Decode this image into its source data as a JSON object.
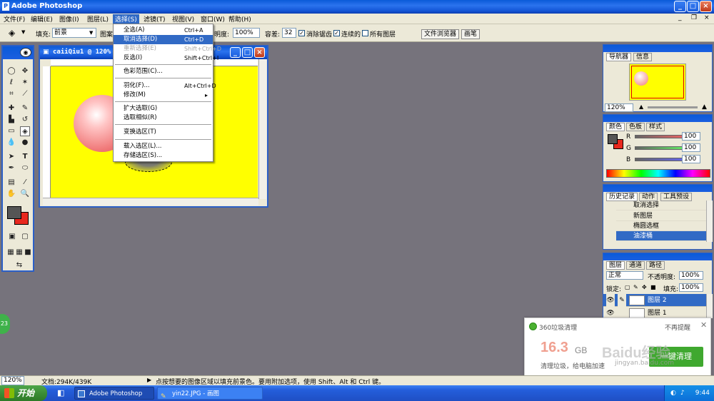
{
  "app": {
    "title": "Adobe Photoshop"
  },
  "menubar": {
    "items": [
      "文件(F)",
      "编辑(E)",
      "图像(I)",
      "图层(L)",
      "选择(S)",
      "滤镜(T)",
      "视图(V)",
      "窗口(W)",
      "帮助(H)"
    ]
  },
  "options": {
    "fill_label": "填充:",
    "fill_value": "前景",
    "pattern_label": "图案",
    "opacity_label": "明度:",
    "opacity_value": "100%",
    "tolerance_label": "容差:",
    "tolerance_value": "32",
    "antialias_label": "消除锯齿",
    "contiguous_label": "连续的",
    "all_layers_label": "所有图层",
    "file_browser_tab": "文件浏览器",
    "brushes_tab": "画笔"
  },
  "document": {
    "title": "caiiQiu1 @ 120%"
  },
  "select_menu": {
    "items": [
      {
        "label": "全选(A)",
        "shortcut": "Ctrl+A"
      },
      {
        "label": "取消选择(D)",
        "shortcut": "Ctrl+D"
      },
      {
        "label": "重新选择(E)",
        "shortcut": "Shift+Ctrl+D"
      },
      {
        "label": "反选(I)",
        "shortcut": "Shift+Ctrl+I"
      },
      {
        "label": "色彩范围(C)...",
        "shortcut": ""
      },
      {
        "label": "羽化(F)...",
        "shortcut": "Alt+Ctrl+D"
      },
      {
        "label": "修改(M)",
        "shortcut": "▸"
      },
      {
        "label": "扩大选取(G)",
        "shortcut": ""
      },
      {
        "label": "选取相似(R)",
        "shortcut": ""
      },
      {
        "label": "变换选区(T)",
        "shortcut": ""
      },
      {
        "label": "载入选区(L)...",
        "shortcut": ""
      },
      {
        "label": "存储选区(S)...",
        "shortcut": ""
      }
    ]
  },
  "navigator": {
    "tabs": [
      "导航器",
      "信息"
    ],
    "zoom": "120%"
  },
  "color_panel": {
    "tabs": [
      "颜色",
      "色板",
      "样式"
    ],
    "r_label": "R",
    "g_label": "G",
    "b_label": "B",
    "r_value": "100",
    "g_value": "100",
    "b_value": "100"
  },
  "history_panel": {
    "tabs": [
      "历史记录",
      "动作",
      "工具预设"
    ],
    "items": [
      "取消选择",
      "新图层",
      "椭圆选框",
      "油漆桶"
    ]
  },
  "layers_panel": {
    "tabs": [
      "图层",
      "通道",
      "路径"
    ],
    "blend_mode": "正常",
    "opacity_label": "不透明度:",
    "opacity_value": "100%",
    "lock_label": "锁定:",
    "fill_label": "填充:",
    "fill_value": "100%",
    "layers": [
      "图层 2",
      "图层 1"
    ]
  },
  "notification": {
    "app": "360垃圾清理",
    "dismiss": "不再提醒",
    "big_text": "16.3",
    "big_unit": "GB",
    "desc": "清理垃圾，给电脑加速",
    "button": "一键清理",
    "watermark": "Baidu经验",
    "watermark_url": "jingyan.baidu.com"
  },
  "statusbar": {
    "zoom": "120%",
    "doc_info": "文档:294K/439K",
    "hint": "点按想要的图像区域以填充前景色。要用附加选项，使用 Shift、Alt 和 Ctrl 键。"
  },
  "taskbar": {
    "start": "开始",
    "tasks": [
      "Adobe Photoshop",
      "yin22.JPG - 画图"
    ],
    "time": "9:44"
  },
  "float_badge": "23",
  "colors": {
    "canvas": "#ffff00",
    "accent": "#316ac5",
    "foreground": "#555555",
    "background": "#e8281e"
  }
}
